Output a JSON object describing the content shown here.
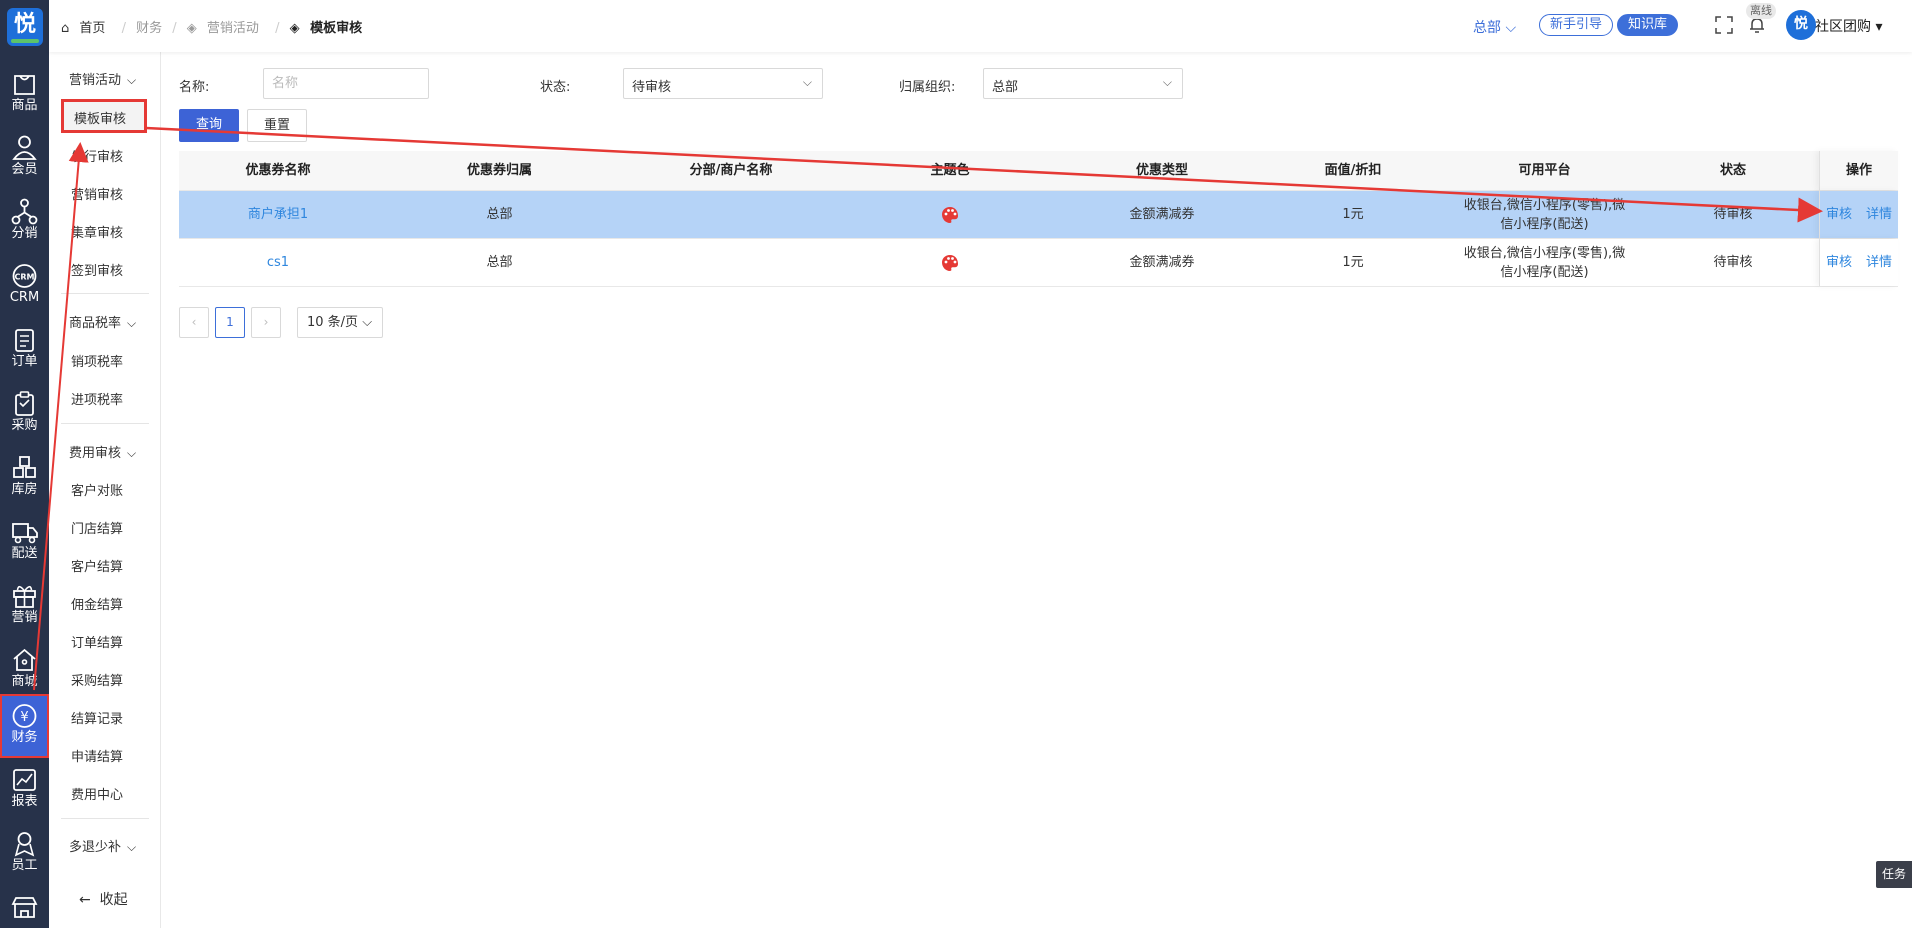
{
  "rail": {
    "logo": "悦",
    "items": [
      {
        "label": "商品",
        "icon": "bag-icon"
      },
      {
        "label": "会员",
        "icon": "user-icon"
      },
      {
        "label": "分销",
        "icon": "distribution-icon"
      },
      {
        "label": "CRM",
        "icon": "crm-icon"
      },
      {
        "label": "订单",
        "icon": "order-icon"
      },
      {
        "label": "采购",
        "icon": "clipboard-icon"
      },
      {
        "label": "库房",
        "icon": "warehouse-icon"
      },
      {
        "label": "配送",
        "icon": "truck-icon"
      },
      {
        "label": "营销",
        "icon": "gift-icon"
      },
      {
        "label": "商城",
        "icon": "home-icon"
      },
      {
        "label": "财务",
        "icon": "yen-icon",
        "active": true
      },
      {
        "label": "报表",
        "icon": "chart-icon"
      },
      {
        "label": "员工",
        "icon": "badge-icon"
      },
      {
        "label": "",
        "icon": "shop-icon"
      }
    ]
  },
  "submenu": {
    "group_marketing": "营销活动",
    "items_marketing": [
      "模板审核",
      "发行审核",
      "营销审核",
      "集章审核",
      "签到审核"
    ],
    "group_tax": "商品税率",
    "items_tax": [
      "销项税率",
      "进项税率"
    ],
    "group_fee": "费用审核",
    "items_fee": [
      "客户对账",
      "门店结算",
      "客户结算",
      "佣金结算",
      "订单结算",
      "采购结算",
      "结算记录",
      "申请结算",
      "费用中心"
    ],
    "group_refund": "多退少补",
    "collapse": "收起"
  },
  "topbar": {
    "breadcrumb": {
      "home": "首页",
      "level1": "财务",
      "level2": "营销活动",
      "current": "模板审核"
    },
    "org": "总部",
    "guide": "新手引导",
    "knowledge": "知识库",
    "offline": "离线",
    "avatar": "悦",
    "user": "社区团购"
  },
  "filters": {
    "name_label": "名称:",
    "name_placeholder": "名称",
    "status_label": "状态:",
    "status_value": "待审核",
    "org_label": "归属组织:",
    "org_value": "总部",
    "query": "查询",
    "reset": "重置"
  },
  "table": {
    "columns": [
      "优惠券名称",
      "优惠券归属",
      "分部/商户名称",
      "主题色",
      "优惠类型",
      "面值/折扣",
      "可用平台",
      "状态",
      "操作"
    ],
    "rows": [
      {
        "name": "商户承担1",
        "owner": "总部",
        "merchant": "",
        "coupon_type": "金额满减券",
        "value": "1元",
        "platform": "收银台,微信小程序(零售),微信小程序(配送)",
        "status": "待审核",
        "op_review": "审核",
        "op_detail": "详情"
      },
      {
        "name": "cs1",
        "owner": "总部",
        "merchant": "",
        "coupon_type": "金额满减券",
        "value": "1元",
        "platform": "收银台,微信小程序(零售),微信小程序(配送)",
        "status": "待审核",
        "op_review": "审核",
        "op_detail": "详情"
      }
    ]
  },
  "pagination": {
    "prev": "‹",
    "page": "1",
    "next": "›",
    "page_size": "10 条/页"
  },
  "task": "任务",
  "colors": {
    "accent": "#3d63d6",
    "rail_bg": "#27324a",
    "annotation": "#e53935",
    "row_selected": "#b5d3f7"
  }
}
